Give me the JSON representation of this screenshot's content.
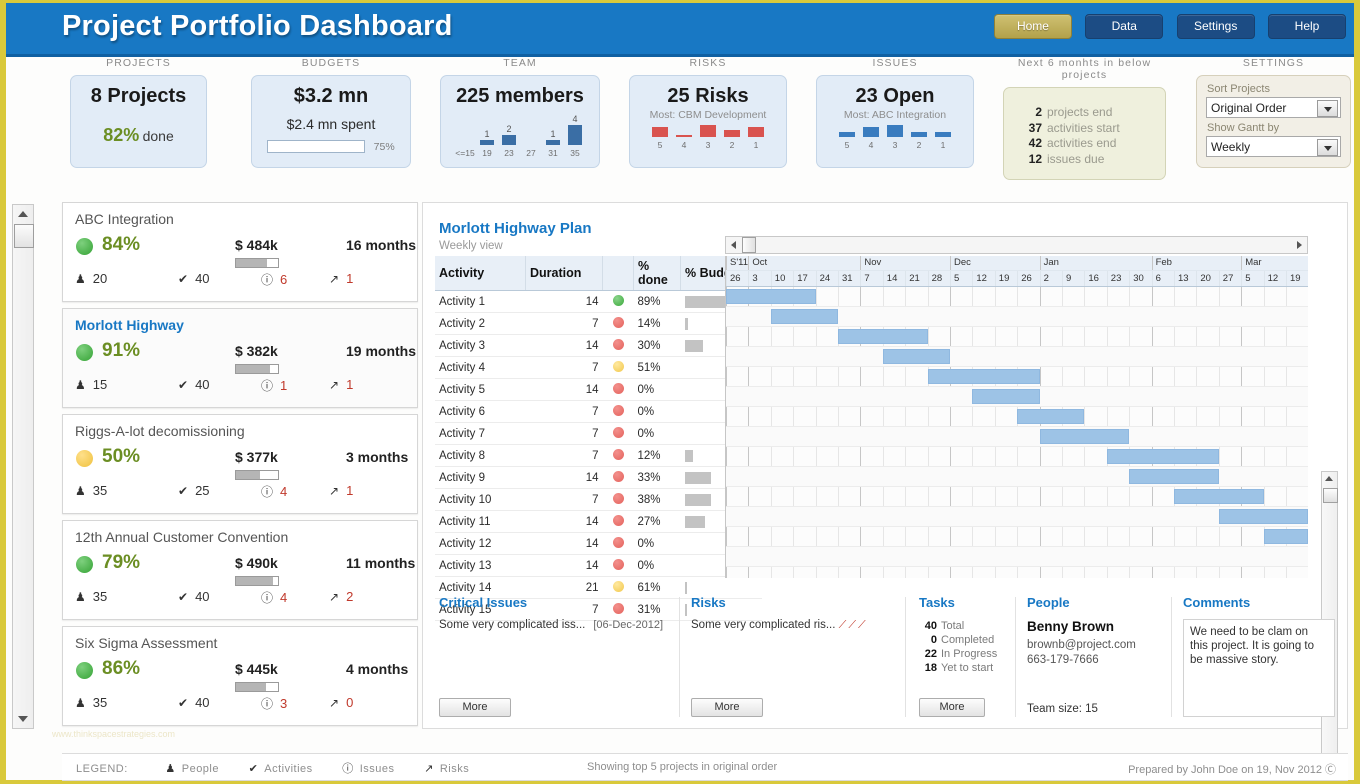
{
  "header": {
    "title": "Project Portfolio Dashboard",
    "nav": [
      {
        "label": "Home",
        "active": true
      },
      {
        "label": "Data",
        "active": false
      },
      {
        "label": "Settings",
        "active": false
      },
      {
        "label": "Help",
        "active": false
      }
    ]
  },
  "kpis": {
    "projects": {
      "caption": "PROJECTS",
      "main": "8 Projects",
      "pct": "82%",
      "pct_label": "done"
    },
    "budgets": {
      "caption": "BUDGETS",
      "main": "$3.2 mn",
      "sub": "$2.4 mn spent",
      "progress_pct": 75,
      "progress_label": "75%"
    },
    "team": {
      "caption": "TEAM",
      "main": "225 members",
      "bars": [
        {
          "label": "<=15",
          "value": 0
        },
        {
          "label": "19",
          "value": 1
        },
        {
          "label": "23",
          "value": 2
        },
        {
          "label": "27",
          "value": 0
        },
        {
          "label": "31",
          "value": 1
        },
        {
          "label": "35",
          "value": 4
        }
      ]
    },
    "risks": {
      "caption": "RISKS",
      "main": "25 Risks",
      "sub": "Most: CBM Development",
      "color": "#d9534f",
      "bars": [
        {
          "label": "5",
          "value": 4
        },
        {
          "label": "4",
          "value": 1
        },
        {
          "label": "3",
          "value": 5
        },
        {
          "label": "2",
          "value": 3
        },
        {
          "label": "1",
          "value": 4
        }
      ]
    },
    "issues": {
      "caption": "ISSUES",
      "main": "23 Open",
      "sub": "Most: ABC Integration",
      "color": "#3a7cbf",
      "bars": [
        {
          "label": "5",
          "value": 2
        },
        {
          "label": "4",
          "value": 4
        },
        {
          "label": "3",
          "value": 5
        },
        {
          "label": "2",
          "value": 2
        },
        {
          "label": "1",
          "value": 2
        }
      ]
    },
    "upcoming": {
      "caption": "Next 6 monhts in below projects",
      "items": [
        {
          "value": "2",
          "label": "projects end"
        },
        {
          "value": "37",
          "label": "activities start"
        },
        {
          "value": "42",
          "label": "activities end"
        },
        {
          "value": "12",
          "label": "issues due"
        }
      ]
    },
    "settings": {
      "caption": "SETTINGS",
      "sort_label": "Sort Projects",
      "sort_value": "Original Order",
      "gantt_label": "Show Gantt by",
      "gantt_value": "Weekly"
    }
  },
  "projects": [
    {
      "name": "ABC Integration",
      "status": "green",
      "pct": "84%",
      "budget": "$ 484k",
      "budget_fill": 74,
      "months": "16 months",
      "people": "20",
      "activities": "40",
      "issues": "6",
      "risks": "1",
      "selected": false
    },
    {
      "name": "Morlott Highway",
      "status": "green",
      "pct": "91%",
      "budget": "$ 382k",
      "budget_fill": 80,
      "months": "19 months",
      "people": "15",
      "activities": "40",
      "issues": "1",
      "risks": "1",
      "selected": true
    },
    {
      "name": "Riggs-A-lot decomissioning",
      "status": "amber",
      "pct": "50%",
      "budget": "$ 377k",
      "budget_fill": 57,
      "months": "3 months",
      "people": "35",
      "activities": "25",
      "issues": "4",
      "risks": "1",
      "selected": false
    },
    {
      "name": "12th Annual Customer Convention",
      "status": "green",
      "pct": "79%",
      "budget": "$ 490k",
      "budget_fill": 88,
      "months": "11 months",
      "people": "35",
      "activities": "40",
      "issues": "4",
      "risks": "2",
      "selected": false
    },
    {
      "name": "Six Sigma Assessment",
      "status": "green",
      "pct": "86%",
      "budget": "$ 445k",
      "budget_fill": 71,
      "months": "4 months",
      "people": "35",
      "activities": "40",
      "issues": "3",
      "risks": "0",
      "selected": false
    }
  ],
  "gantt_panel": {
    "title": "Morlott Highway Plan",
    "subtitle": "Weekly view",
    "columns": [
      "Activity",
      "Duration",
      "% done",
      "% Budget"
    ],
    "months": [
      {
        "label": "S'11",
        "weeks": 1
      },
      {
        "label": "Oct",
        "weeks": 5
      },
      {
        "label": "Nov",
        "weeks": 4
      },
      {
        "label": "Dec",
        "weeks": 4
      },
      {
        "label": "Jan",
        "weeks": 5
      },
      {
        "label": "Feb",
        "weeks": 4
      },
      {
        "label": "Mar",
        "weeks": 3
      }
    ],
    "days": [
      "26",
      "3",
      "10",
      "17",
      "24",
      "31",
      "7",
      "14",
      "21",
      "28",
      "5",
      "12",
      "19",
      "26",
      "2",
      "9",
      "16",
      "23",
      "30",
      "6",
      "13",
      "20",
      "27",
      "5",
      "12",
      "19"
    ],
    "activities": [
      {
        "name": "Activity 1",
        "duration": "14",
        "status": "green",
        "done": "89%",
        "budget": 100,
        "bar_start": 0,
        "bar_len": 4
      },
      {
        "name": "Activity 2",
        "duration": "7",
        "status": "red",
        "done": "14%",
        "budget": 4,
        "bar_start": 2,
        "bar_len": 3
      },
      {
        "name": "Activity 3",
        "duration": "14",
        "status": "red",
        "done": "30%",
        "budget": 28,
        "bar_start": 5,
        "bar_len": 4
      },
      {
        "name": "Activity 4",
        "duration": "7",
        "status": "amber",
        "done": "51%",
        "budget": 0,
        "bar_start": 7,
        "bar_len": 3
      },
      {
        "name": "Activity 5",
        "duration": "14",
        "status": "red",
        "done": "0%",
        "budget": 0,
        "bar_start": 9,
        "bar_len": 5
      },
      {
        "name": "Activity 6",
        "duration": "7",
        "status": "red",
        "done": "0%",
        "budget": 0,
        "bar_start": 11,
        "bar_len": 3
      },
      {
        "name": "Activity 7",
        "duration": "7",
        "status": "red",
        "done": "0%",
        "budget": 0,
        "bar_start": 13,
        "bar_len": 3
      },
      {
        "name": "Activity 8",
        "duration": "7",
        "status": "red",
        "done": "12%",
        "budget": 13,
        "bar_start": 14,
        "bar_len": 4
      },
      {
        "name": "Activity 9",
        "duration": "14",
        "status": "red",
        "done": "33%",
        "budget": 40,
        "bar_start": 17,
        "bar_len": 5
      },
      {
        "name": "Activity 10",
        "duration": "7",
        "status": "red",
        "done": "38%",
        "budget": 40,
        "bar_start": 18,
        "bar_len": 4
      },
      {
        "name": "Activity 11",
        "duration": "14",
        "status": "red",
        "done": "27%",
        "budget": 32,
        "bar_start": 20,
        "bar_len": 4
      },
      {
        "name": "Activity 12",
        "duration": "14",
        "status": "red",
        "done": "0%",
        "budget": 0,
        "bar_start": 22,
        "bar_len": 4
      },
      {
        "name": "Activity 13",
        "duration": "14",
        "status": "red",
        "done": "0%",
        "budget": 0,
        "bar_start": 24,
        "bar_len": 2
      },
      {
        "name": "Activity 14",
        "duration": "21",
        "status": "amber",
        "done": "61%",
        "budget": 2,
        "bar_start": -1,
        "bar_len": 0
      },
      {
        "name": "Activity 15",
        "duration": "7",
        "status": "red",
        "done": "31%",
        "budget": 2,
        "bar_start": -1,
        "bar_len": 0
      }
    ]
  },
  "bottom": {
    "critical_issues": {
      "title": "Critical Issues",
      "text": "Some very complicated iss...",
      "date": "[06-Dec-2012]",
      "more": "More"
    },
    "risks": {
      "title": "Risks",
      "text": "Some very complicated ris...",
      "icons": "⟋⟋⟋",
      "more": "More"
    },
    "tasks": {
      "title": "Tasks",
      "rows": [
        {
          "value": "40",
          "label": "Total"
        },
        {
          "value": "0",
          "label": "Completed"
        },
        {
          "value": "22",
          "label": "In Progress"
        },
        {
          "value": "18",
          "label": "Yet to start"
        }
      ],
      "more": "More"
    },
    "people": {
      "title": "People",
      "name": "Benny Brown",
      "email": "brownb@project.com",
      "phone": "663-179-7666",
      "team_size": "Team size: 15"
    },
    "comments": {
      "title": "Comments",
      "text": "We need to be clam on this project. It is going to be massive story."
    }
  },
  "footer": {
    "legend_label": "LEGEND:",
    "legend_items": [
      {
        "icon": "people-icon",
        "label": "People"
      },
      {
        "icon": "check-icon",
        "label": "Activities"
      },
      {
        "icon": "info-icon",
        "label": "Issues"
      },
      {
        "icon": "risk-icon",
        "label": "Risks"
      }
    ],
    "middle": "Showing top 5 projects in original order",
    "right": "Prepared by John Doe on 19, Nov 2012"
  },
  "watermark": "www.thinkspacestrategies.com"
}
